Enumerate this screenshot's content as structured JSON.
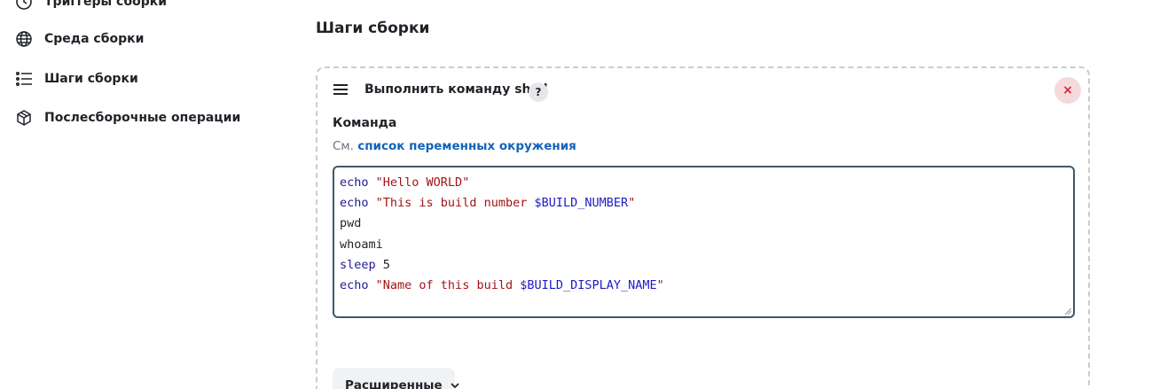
{
  "sidebar": {
    "items": [
      {
        "label": "Триггеры сборки",
        "icon": "clock-icon"
      },
      {
        "label": "Среда сборки",
        "icon": "globe-icon"
      },
      {
        "label": "Шаги сборки",
        "icon": "list-icon"
      },
      {
        "label": "Послесборочные операции",
        "icon": "package-icon"
      }
    ]
  },
  "main": {
    "section_title": "Шаги сборки",
    "step": {
      "title": "Выполнить команду shell",
      "help_label": "?",
      "remove_label": "×",
      "field_label": "Команда",
      "env_prefix": "См.",
      "env_link": "список переменных окружения",
      "code": {
        "line1": {
          "kw": "echo",
          "str": "\"Hello WORLD\""
        },
        "line2": {
          "kw": "echo",
          "str1": "\"This is build number ",
          "var": "$BUILD_NUMBER",
          "str2": "\""
        },
        "line3": {
          "text": "pwd"
        },
        "line4": {
          "text": "whoami"
        },
        "line5": {
          "kw": "sleep",
          "text": " 5"
        },
        "line6": {
          "kw": "echo",
          "str1": "\"Name of this build ",
          "var": "$BUILD_DISPLAY_NAME",
          "str2": "\""
        }
      },
      "advanced_label": "Расширенные"
    }
  },
  "colors": {
    "link": "#1463b8",
    "keyword": "#1e1a91",
    "string": "#a21414",
    "variable": "#1e1ac4",
    "remove_bg": "#f6d9dc",
    "remove_fg": "#d3263b",
    "textarea_border": "#3d5a66"
  }
}
